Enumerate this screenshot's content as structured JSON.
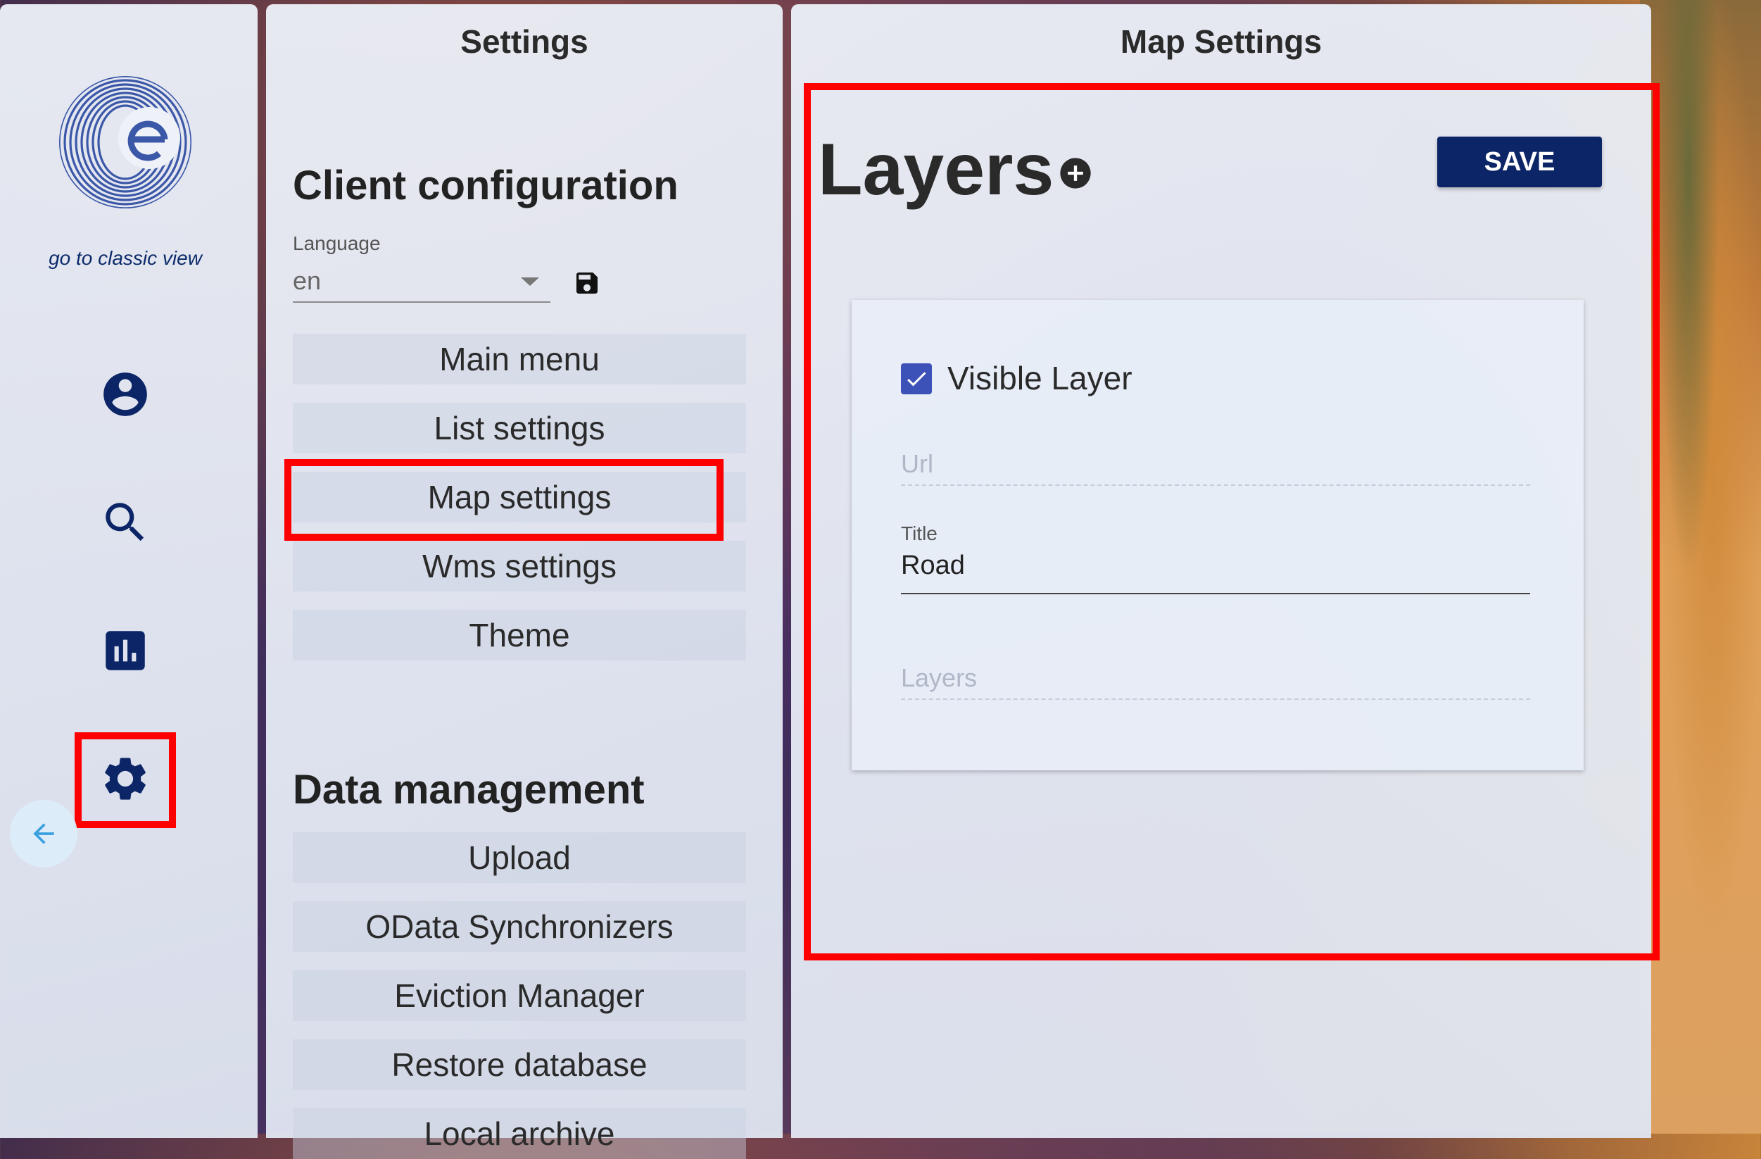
{
  "rail": {
    "classic_link": "go to classic view",
    "icons": {
      "profile": "account-circle-icon",
      "search": "search-icon",
      "stats": "bar-chart-icon",
      "settings": "gear-icon",
      "back": "arrow-left-icon"
    }
  },
  "settings_panel": {
    "title": "Settings",
    "client_config_title": "Client configuration",
    "language_label": "Language",
    "language_value": "en",
    "menu": [
      "Main menu",
      "List settings",
      "Map settings",
      "Wms settings",
      "Theme"
    ],
    "selected_menu": "Map settings",
    "data_management_title": "Data management",
    "data_menu": [
      "Upload",
      "OData Synchronizers",
      "Eviction Manager",
      "Restore database",
      "Local archive"
    ]
  },
  "map_panel": {
    "title": "Map Settings",
    "layers_title": "Layers",
    "save_label": "SAVE",
    "layer": {
      "visible_label": "Visible Layer",
      "visible_checked": true,
      "url_placeholder": "Url",
      "title_label": "Title",
      "title_value": "Road",
      "layers_placeholder": "Layers"
    }
  },
  "colors": {
    "accent": "#0b2566",
    "highlight": "#ff0000",
    "checkbox": "#3d52b8"
  }
}
